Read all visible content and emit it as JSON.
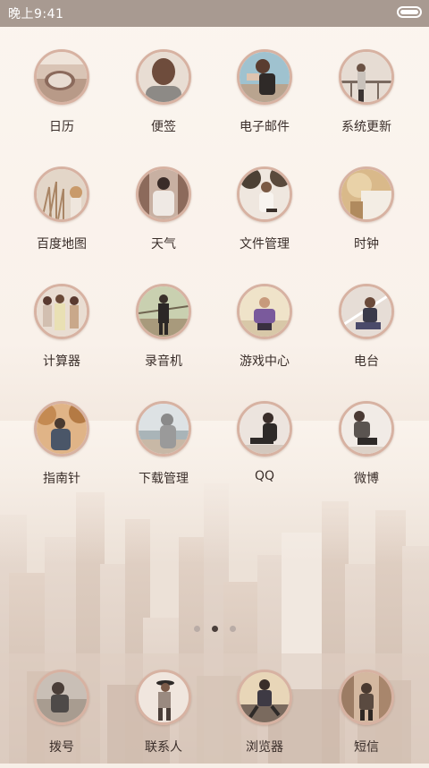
{
  "status_bar": {
    "time": "晚上9:41"
  },
  "apps": [
    {
      "label": "日历",
      "icon": "car-mirror-photo-icon"
    },
    {
      "label": "便签",
      "icon": "back-of-head-photo-icon"
    },
    {
      "label": "电子邮件",
      "icon": "person-photo-icon"
    },
    {
      "label": "系统更新",
      "icon": "railing-photo-icon"
    },
    {
      "label": "百度地图",
      "icon": "dry-grass-photo-icon"
    },
    {
      "label": "天气",
      "icon": "street-back-photo-icon"
    },
    {
      "label": "文件管理",
      "icon": "trees-photo-icon"
    },
    {
      "label": "时钟",
      "icon": "blurred-warm-photo-icon"
    },
    {
      "label": "计算器",
      "icon": "group-photo-icon"
    },
    {
      "label": "录音机",
      "icon": "walkway-photo-icon"
    },
    {
      "label": "游戏中心",
      "icon": "purple-shirt-photo-icon"
    },
    {
      "label": "电台",
      "icon": "road-photo-icon"
    },
    {
      "label": "指南针",
      "icon": "autumn-photo-icon"
    },
    {
      "label": "下载管理",
      "icon": "sea-hoodie-photo-icon"
    },
    {
      "label": "QQ",
      "icon": "sitting-photo-icon"
    },
    {
      "label": "微博",
      "icon": "crouching-photo-icon"
    }
  ],
  "pager": {
    "count": 3,
    "active_index": 1
  },
  "dock": [
    {
      "label": "拨号",
      "icon": "hat-man-photo-icon"
    },
    {
      "label": "联系人",
      "icon": "hat-woman-photo-icon"
    },
    {
      "label": "浏览器",
      "icon": "jump-photo-icon"
    },
    {
      "label": "短信",
      "icon": "street-walk-photo-icon"
    }
  ],
  "colors": {
    "status_bar": "#a89a91",
    "ring": "#d7b2a2",
    "label": "#3a2e2a"
  }
}
